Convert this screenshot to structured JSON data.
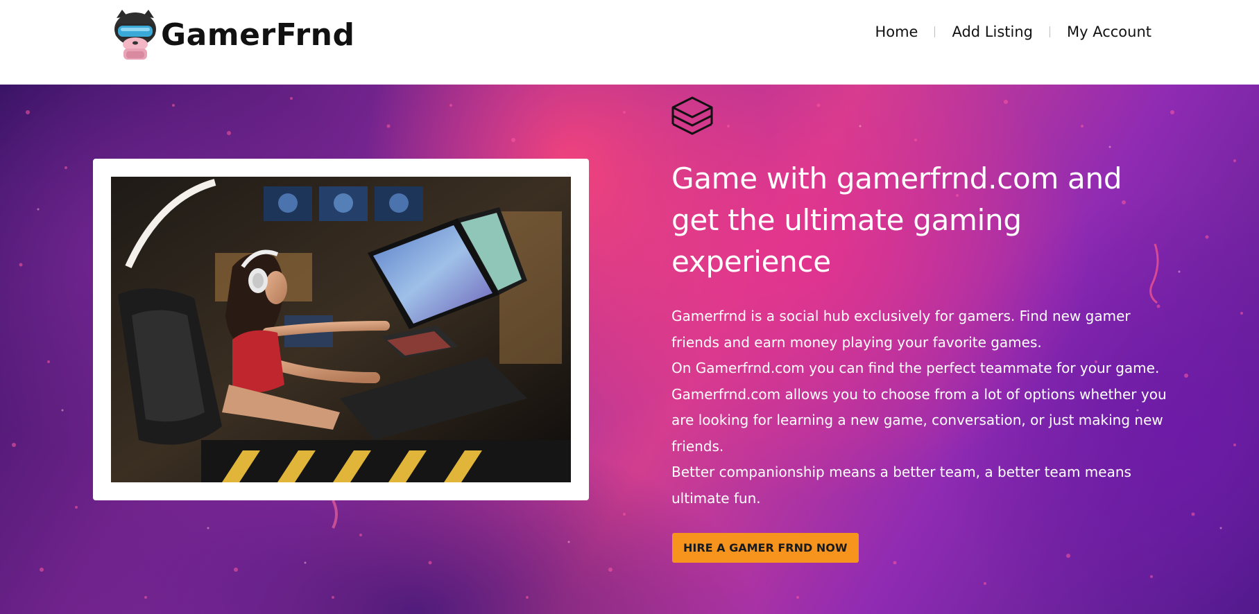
{
  "header": {
    "logo_text": "GamerFrnd",
    "nav": [
      {
        "label": "Home"
      },
      {
        "label": "Add Listing"
      },
      {
        "label": "My Account"
      }
    ]
  },
  "hero": {
    "icon": "layers-icon",
    "headline": "Game with gamerfrnd.com and get the ultimate gaming experience",
    "paragraphs": [
      "Gamerfrnd is a social hub exclusively for gamers. Find new gamer friends and earn money playing your favorite games.",
      "On Gamerfrnd.com you can find the perfect teammate for your game.",
      "Gamerfrnd.com allows you to choose from a lot of options whether you are looking for learning a new game, conversation, or just making new friends.",
      "Better companionship means a better team, a better team means ultimate fun."
    ],
    "cta_label": "HIRE A GAMER FRND NOW",
    "accent_color": "#f7941d"
  }
}
